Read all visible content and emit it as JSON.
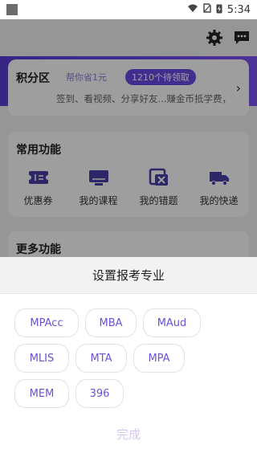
{
  "status_bar": {
    "time": "5:34"
  },
  "points_card": {
    "title": "积分区",
    "subtitle": "帮你省1元",
    "badge": "1210个待领取",
    "description": "签到、看视频、分享好友...赚金币抵学费，"
  },
  "common_functions": {
    "title": "常用功能",
    "items": [
      {
        "label": "优惠券",
        "icon": "coupon-icon"
      },
      {
        "label": "我的课程",
        "icon": "monitor-icon"
      },
      {
        "label": "我的错题",
        "icon": "wrong-question-icon"
      },
      {
        "label": "我的快递",
        "icon": "truck-icon"
      }
    ]
  },
  "more_functions": {
    "title": "更多功能"
  },
  "sheet": {
    "title": "设置报考专业",
    "majors": [
      "MPAcc",
      "MBA",
      "MAud",
      "MLIS",
      "MTA",
      "MPA",
      "MEM",
      "396"
    ],
    "done_label": "完成"
  },
  "colors": {
    "accent": "#6d4fd8",
    "band": "#6b4ae6"
  }
}
